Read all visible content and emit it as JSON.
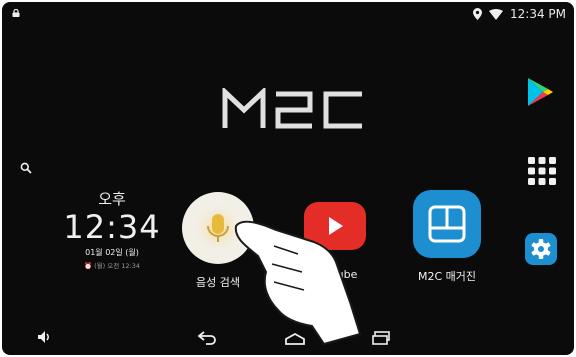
{
  "status": {
    "time": "12:34 PM"
  },
  "logo": {
    "text": "M2C"
  },
  "clock": {
    "ampm": "오후",
    "time": "12:34",
    "date": "01월 02일 (월)",
    "alarm": "(월) 오전 12:34"
  },
  "apps": [
    {
      "label": "음성 검색"
    },
    {
      "label": "YouTube"
    },
    {
      "label": "M2C 매거진"
    }
  ],
  "colors": {
    "background": "#0b0b0c",
    "youtube": "#e52d27",
    "magazine": "#1d8fd0",
    "settings": "#1d8fd0"
  },
  "icons": [
    "lock-icon",
    "location-icon",
    "wifi-icon",
    "search-icon",
    "play-store-icon",
    "app-grid-icon",
    "settings-icon",
    "volume-icon",
    "back-icon",
    "home-icon",
    "recents-icon",
    "microphone-icon",
    "hand-pointer-icon"
  ]
}
